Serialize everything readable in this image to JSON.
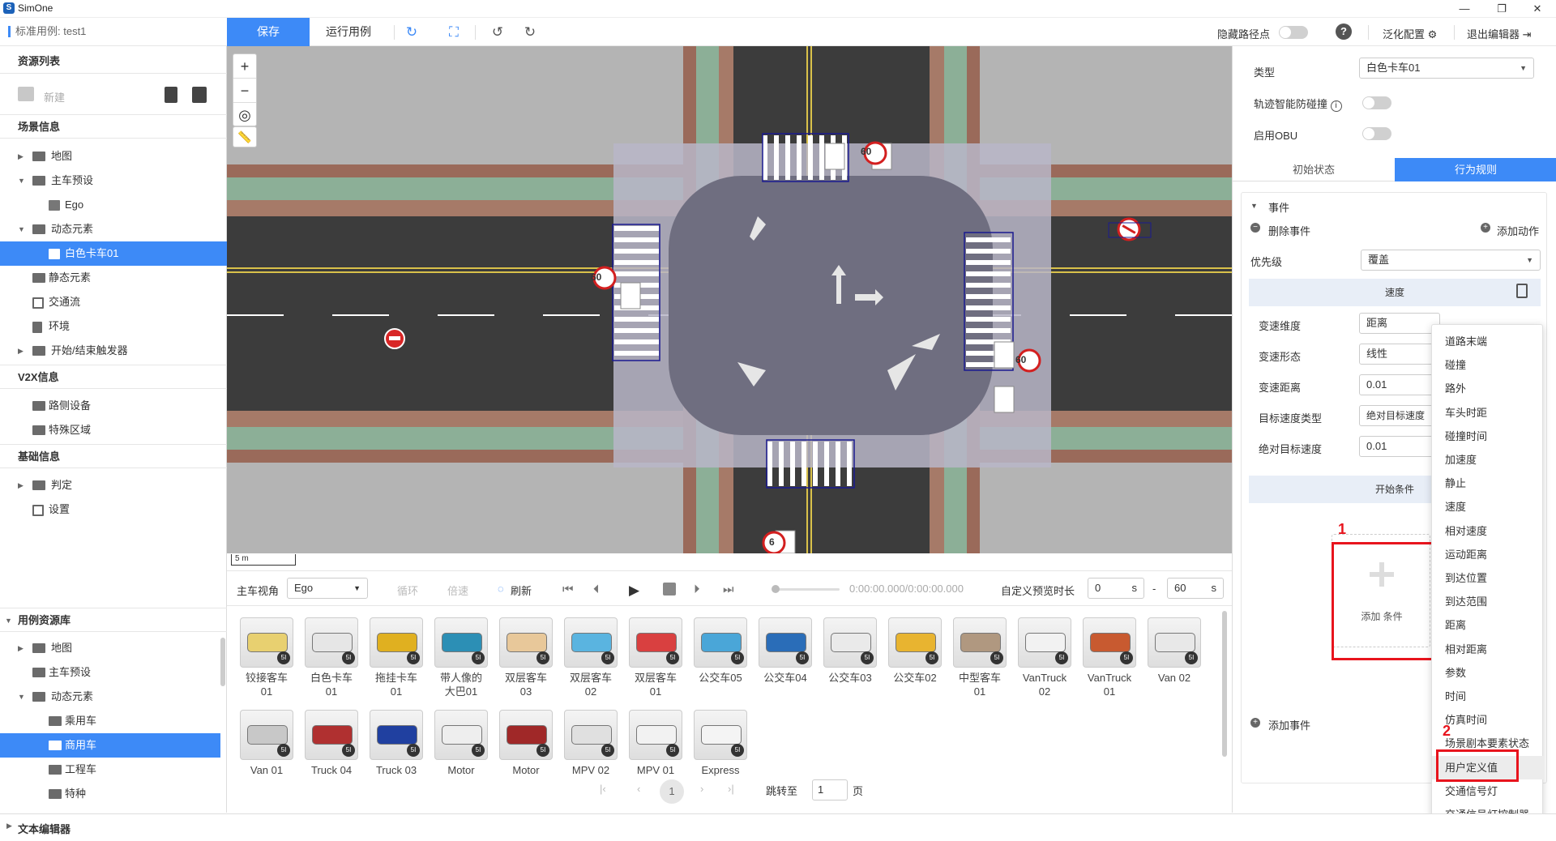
{
  "app": {
    "name": "SimOne",
    "window_controls": [
      "—",
      "❐",
      "✕"
    ]
  },
  "toolbar": {
    "case_label": "标准用例: test1",
    "save": "保存",
    "run": "运行用例",
    "hide_path_points": "隐藏路径点",
    "generalize_config": "泛化配置",
    "exit_editor": "退出编辑器"
  },
  "left": {
    "resource_list": "资源列表",
    "new_label": "新建",
    "scene_info": "场景信息",
    "scene_tree": [
      "地图",
      "主车预设",
      "Ego",
      "动态元素",
      "白色卡车01",
      "静态元素",
      "交通流",
      "环境",
      "开始/结束触发器"
    ],
    "v2x": "V2X信息",
    "v2x_items": [
      "路侧设备",
      "特殊区域"
    ],
    "base_info": "基础信息",
    "base_items": [
      "判定",
      "设置"
    ],
    "case_lib": "用例资源库",
    "lib_tree": [
      "地图",
      "主车预设",
      "动态元素",
      "乘用车",
      "商用车",
      "工程车",
      "特种"
    ]
  },
  "map": {
    "scale_label": "5 m",
    "speed_signs": [
      "60",
      "60",
      "60",
      "6",
      "60"
    ]
  },
  "playbar": {
    "view_label": "主车视角",
    "view_value": "Ego",
    "loop": "循环",
    "speed": "倍速",
    "refresh": "刷新",
    "time": "0:00:00.000/0:00:00.000",
    "custom_duration": "自定义预览时长",
    "start_value": "0",
    "end_value": "60",
    "unit": "s",
    "dash": "-"
  },
  "assets": [
    {
      "name": "铰接客车\n01",
      "color": "#e8d070"
    },
    {
      "name": "白色卡车\n01",
      "color": "#e6e6e6"
    },
    {
      "name": "拖挂卡车\n01",
      "color": "#e0b020"
    },
    {
      "name": "带人像的\n大巴01",
      "color": "#2c8fb5"
    },
    {
      "name": "双层客车\n03",
      "color": "#e8c89a"
    },
    {
      "name": "双层客车\n02",
      "color": "#5ab4e0"
    },
    {
      "name": "双层客车\n01",
      "color": "#d94040"
    },
    {
      "name": "公交车05",
      "color": "#4aa6d8"
    },
    {
      "name": "公交车04",
      "color": "#2a6db8"
    },
    {
      "name": "公交车03",
      "color": "#eaeaea"
    },
    {
      "name": "公交车02",
      "color": "#e8b430"
    },
    {
      "name": "中型客车\n01",
      "color": "#b09880"
    },
    {
      "name": "VanTruck\n02",
      "color": "#f2f2f2"
    },
    {
      "name": "VanTruck\n01",
      "color": "#c85a30"
    },
    {
      "name": "Van 02",
      "color": "#e8e8e8"
    },
    {
      "name": "Van 01",
      "color": "#c8c8c8"
    },
    {
      "name": "Truck 04",
      "color": "#b03030"
    },
    {
      "name": "Truck 03",
      "color": "#2040a0"
    },
    {
      "name": "Motor",
      "color": "#eeeeee"
    },
    {
      "name": "Motor",
      "color": "#a02828"
    },
    {
      "name": "MPV 02",
      "color": "#e0e0e0"
    },
    {
      "name": "MPV 01",
      "color": "#f2f2f2"
    },
    {
      "name": "Express",
      "color": "#f4f4f4"
    }
  ],
  "pager": {
    "current": "1",
    "goto": "跳转至",
    "page_value": "1",
    "page_unit": "页"
  },
  "right": {
    "type_label": "类型",
    "type_value": "白色卡车01",
    "smart_collision": "轨迹智能防碰撞",
    "obu": "启用OBU",
    "tab_initial": "初始状态",
    "tab_behavior": "行为规则",
    "event": "事件",
    "delete_event": "删除事件",
    "add_action": "添加动作",
    "priority_label": "优先级",
    "priority_value": "覆盖",
    "speed_header": "速度",
    "fields": [
      {
        "label": "变速维度",
        "value": "距离"
      },
      {
        "label": "变速形态",
        "value": "线性"
      },
      {
        "label": "变速距离",
        "value": "0.01"
      },
      {
        "label": "目标速度类型",
        "value": "绝对目标速度"
      },
      {
        "label": "绝对目标速度",
        "value": "0.01"
      }
    ],
    "start_condition": "开始条件",
    "add_condition": "添加 条件",
    "add_event": "添加事件"
  },
  "menu": [
    "道路末端",
    "碰撞",
    "路外",
    "车头时距",
    "碰撞时间",
    "加速度",
    "静止",
    "速度",
    "相对速度",
    "运动距离",
    "到达位置",
    "到达范围",
    "距离",
    "相对距离",
    "参数",
    "时间",
    "仿真时间",
    "场景剧本要素状态",
    "用户定义值",
    "交通信号灯",
    "交通信号灯控制器"
  ],
  "annotations": {
    "num1": "1",
    "num2": "2"
  },
  "bottom": {
    "text_editor": "文本编辑器"
  }
}
